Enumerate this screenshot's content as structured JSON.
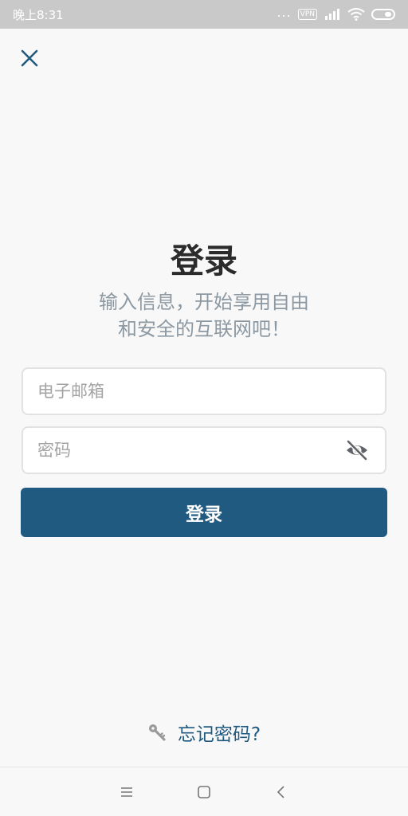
{
  "status_bar": {
    "time": "晚上8:31",
    "dots": "...",
    "vpn_label": "VPN",
    "icons": [
      "signal-icon",
      "wifi-icon",
      "battery-icon"
    ]
  },
  "header": {
    "close_icon": "close-icon"
  },
  "login": {
    "title": "登录",
    "subtitle_line1": "输入信息，开始享用自由",
    "subtitle_line2": "和安全的互联网吧！",
    "email_placeholder": "电子邮箱",
    "email_value": "",
    "password_placeholder": "密码",
    "password_value": "",
    "password_toggle_icon": "eye-off-icon",
    "submit_label": "登录"
  },
  "footer": {
    "forgot_icon": "key-icon",
    "forgot_label": "忘记密码?"
  },
  "nav": {
    "items": [
      "menu-icon",
      "home-square-icon",
      "back-chevron-icon"
    ]
  },
  "colors": {
    "accent": "#215a80",
    "title": "#2b2b2b",
    "subtitle": "#8c98a2",
    "background": "#f8f8f8",
    "status_bar": "#c9c9c9"
  }
}
